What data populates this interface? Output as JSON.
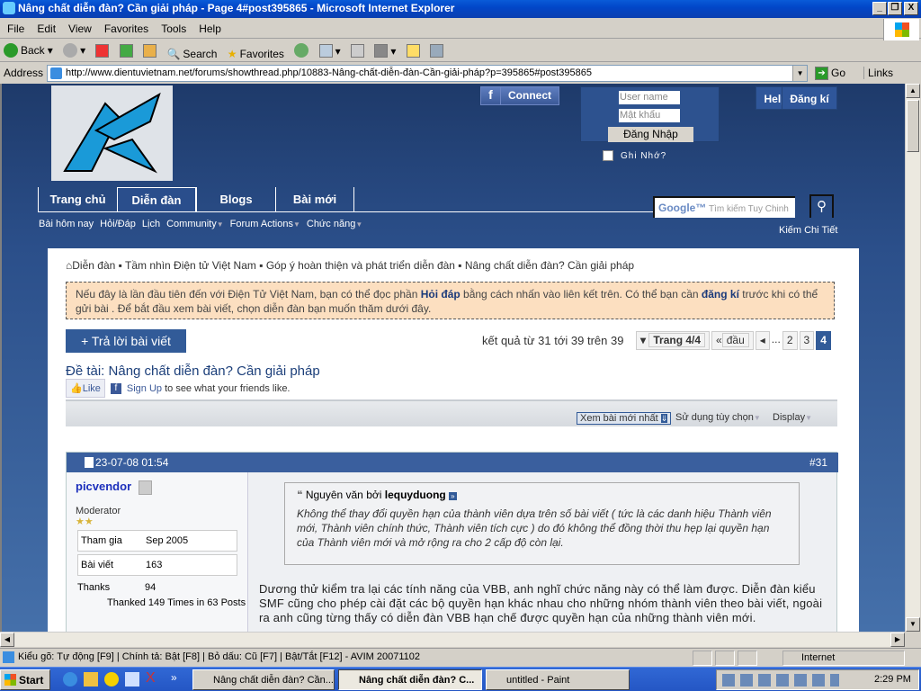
{
  "window": {
    "title": "Nâng chất diễn đàn? Cần giải pháp - Page 4#post395865 - Microsoft Internet Explorer"
  },
  "menu": [
    "File",
    "Edit",
    "View",
    "Favorites",
    "Tools",
    "Help"
  ],
  "toolbar": {
    "back": "Back",
    "search": "Search",
    "favorites": "Favorites"
  },
  "address": {
    "label": "Address",
    "url": "http://www.dientuvietnam.net/forums/showthread.php/10883-Nâng-chất-diễn-đàn-Cần-giải-pháp?p=395865#post395865",
    "go": "Go",
    "links": "Links"
  },
  "header": {
    "connect": "Connect",
    "username_placeholder": "User name",
    "password_placeholder": "Mật khẩu",
    "login": "Đăng Nhập",
    "remember": "Ghi Nhớ?",
    "help": "Help",
    "register": "Đăng kí"
  },
  "nav": {
    "tabs": [
      "Trang chủ",
      "Diễn đàn",
      "Blogs",
      "Bài mới"
    ],
    "sub": [
      "Bài hôm nay",
      "Hỏi/Đáp",
      "Lịch",
      "Community",
      "Forum Actions",
      "Chức năng"
    ],
    "search_placeholder": "Tìm kiếm Tuy Chinh",
    "google": "Google™",
    "advanced": "Kiếm Chi Tiết"
  },
  "breadcrumb": [
    "Diễn đàn",
    "Tầm nhìn Điện tử Việt Nam",
    "Góp ý hoàn thiện và phát triển diễn đàn",
    "Nâng chất diễn đàn? Cần giải pháp"
  ],
  "notice": {
    "p1": "Nếu đây là lần đầu tiên đến với Điện Tử Việt Nam, bạn có thể đọc phần ",
    "link1": "Hỏi đáp",
    "p2": " bằng cách nhấn vào liên kết trên. Có thể bạn cần ",
    "link2": "đăng kí",
    "p3": " trước khi có thể gửi bài . Để bắt đầu xem bài viết, chọn diễn đàn bạn muốn thăm dưới đây."
  },
  "reply_button": "+ Trả lời bài viết",
  "results": "kết quả từ 31 tới 39 trên 39",
  "pager": {
    "label": "Trang 4/4",
    "first": "đầu",
    "ellipsis": "...",
    "pages": [
      "2",
      "3",
      "4"
    ],
    "current": "4"
  },
  "thread": {
    "title": "Đề tài: Nâng chất diễn đàn? Cần giải pháp",
    "like": "Like",
    "signup": "Sign Up",
    "signup_rest": " to see what your friends like."
  },
  "tools": {
    "newest": "Xem bài mới nhất",
    "options": "Sử dụng tùy chọn",
    "display": "Display"
  },
  "post": {
    "date": "23-07-08 01:54",
    "number": "#31",
    "username": "picvendor",
    "role": "Moderator",
    "joined_label": "Tham gia",
    "joined": "Sep 2005",
    "posts_label": "Bài viết",
    "posts": "163",
    "thanks_label": "Thanks",
    "thanks": "94",
    "thanked": "Thanked 149 Times in 63 Posts",
    "quote_prefix": "Nguyên văn bởi",
    "quote_author": "lequyduong",
    "quote_text": "Không thể thay đổi quyền hạn của thành viên dựa trên số bài viết ( tức là các danh hiệu Thành viên mới, Thành viên chính thức, Thành viên tích cực ) do đó không thể đồng thời thu hẹp lại quyền hạn của Thành viên mới và mở rộng ra cho 2 cấp độ còn lại.",
    "message": "Dương thử kiểm tra lại các tính năng của VBB, anh nghĩ chức năng này có thể làm được. Diễn đàn kiểu SMF cũng cho phép cài đặt các bộ quyền hạn khác nhau cho những nhóm thành viên theo bài viết, ngoài ra anh cũng từng thấy có diễn đàn VBB hạn chế được quyền hạn của những thành viên mới."
  },
  "status": {
    "text": "Kiểu gõ: Tự động [F9] | Chính tả: Bật [F8] | Bỏ dấu: Cũ [F7] | Bật/Tắt [F12] - AVIM 20071102",
    "zone": "Internet"
  },
  "taskbar": {
    "start": "Start",
    "tasks": [
      "Nâng chất diễn đàn? Cần...",
      "Nâng chất diễn đàn? C...",
      "untitled - Paint"
    ],
    "clock": "2:29 PM"
  }
}
